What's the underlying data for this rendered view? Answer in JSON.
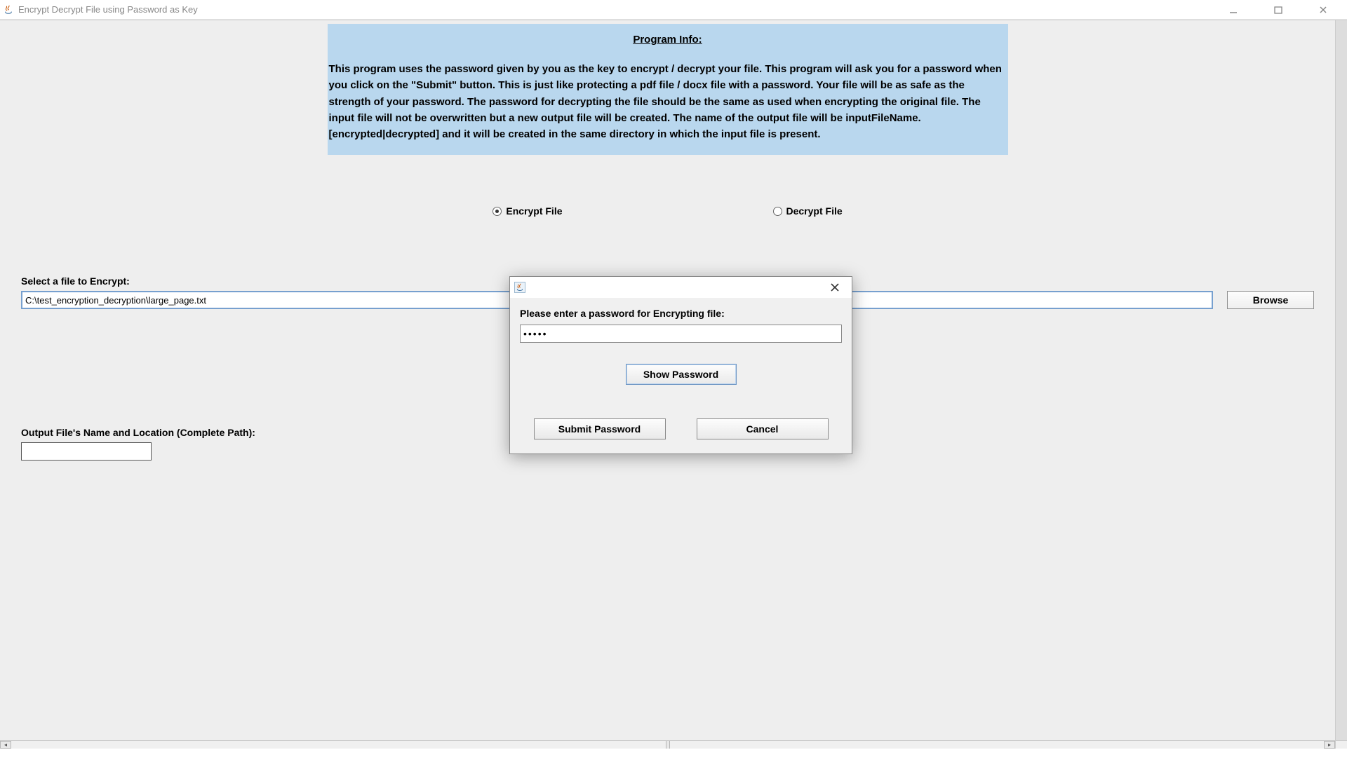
{
  "window": {
    "title": "Encrypt Decrypt File using Password as Key"
  },
  "info": {
    "heading": "Program Info:",
    "body": "This program uses the password given by you as the key to encrypt / decrypt your file. This program will ask you for a password when you click on the \"Submit\" button. This is just like protecting a pdf file / docx file with a password. Your file will be as safe as the strength of your password. The password for decrypting the file should be the same as used when encrypting the original file. The input file will not be overwritten but a new output file will be created. The name of the output file will be inputFileName.[encrypted|decrypted] and it will be created in the same directory in which the input file is present."
  },
  "radios": {
    "encrypt": "Encrypt File",
    "decrypt": "Decrypt File",
    "selected": "encrypt"
  },
  "input_file": {
    "label": "Select a file to Encrypt:",
    "value": "C:\\test_encryption_decryption\\large_page.txt",
    "browse": "Browse"
  },
  "output_file": {
    "label": "Output File's Name and Location (Complete Path):",
    "value": ""
  },
  "dialog": {
    "prompt": "Please enter a password for Encrypting file:",
    "password_display": "•••••",
    "show": "Show Password",
    "submit": "Submit Password",
    "cancel": "Cancel"
  }
}
